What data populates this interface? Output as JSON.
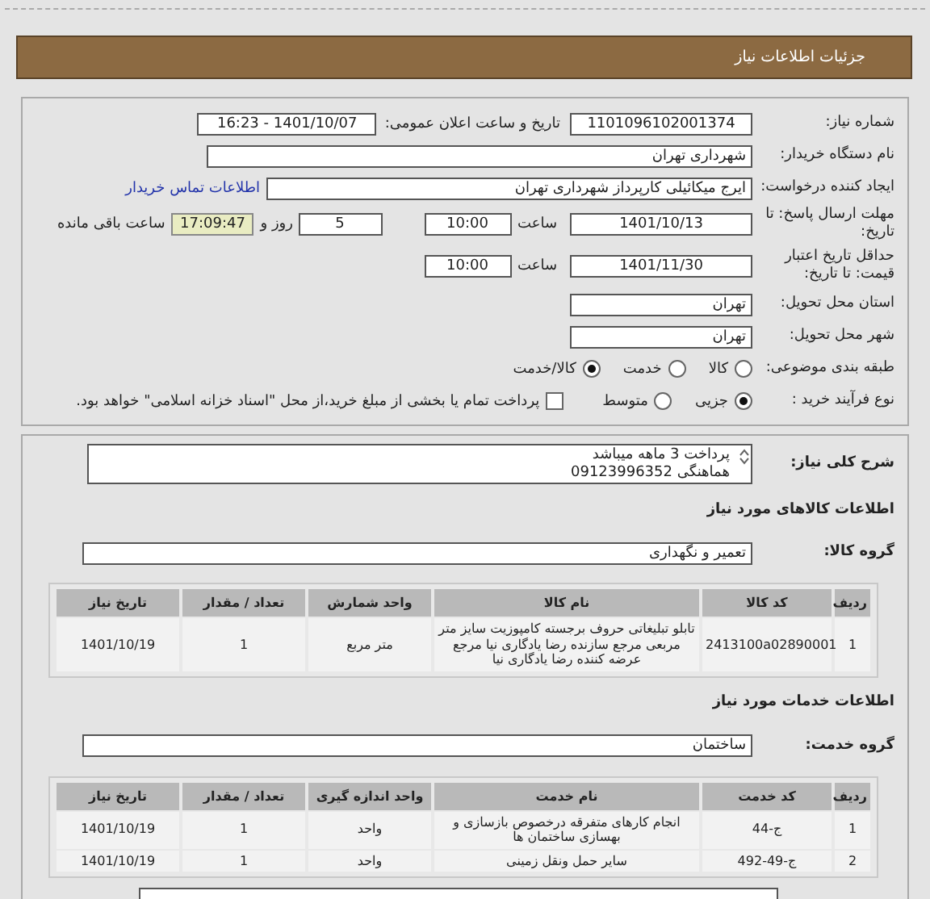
{
  "header": {
    "title": "جزئیات اطلاعات نیاز"
  },
  "need_number": {
    "label": "شماره نیاز:",
    "value": "1101096102001374"
  },
  "announce": {
    "label": "تاریخ و ساعت اعلان عمومی:",
    "value": "1401/10/07 - 16:23"
  },
  "buyer": {
    "label": "نام دستگاه خریدار:",
    "value": "شهرداری تهران"
  },
  "requester": {
    "label": "ایجاد کننده درخواست:",
    "value": "ایرج میکائیلی کارپرداز شهرداری تهران",
    "link": "اطلاعات تماس خریدار"
  },
  "deadline": {
    "label": "مهلت ارسال پاسخ: تا تاریخ:",
    "date": "1401/10/13",
    "time_label": "ساعت",
    "time": "10:00",
    "days": "5",
    "days_label": "روز و",
    "remaining": "17:09:47",
    "remaining_label": "ساعت باقی مانده"
  },
  "validity": {
    "label": "حداقل تاریخ اعتبار قیمت: تا تاریخ:",
    "date": "1401/11/30",
    "time_label": "ساعت",
    "time": "10:00"
  },
  "province": {
    "label": "استان محل تحویل:",
    "value": "تهران"
  },
  "city": {
    "label": "شهر محل تحویل:",
    "value": "تهران"
  },
  "category": {
    "label": "طبقه بندی موضوعی:",
    "options": [
      {
        "label": "کالا",
        "selected": false
      },
      {
        "label": "خدمت",
        "selected": false
      },
      {
        "label": "کالا/خدمت",
        "selected": true
      }
    ]
  },
  "process": {
    "label": "نوع فرآیند خرید :",
    "options": [
      {
        "label": "جزیی",
        "selected": true
      },
      {
        "label": "متوسط",
        "selected": false
      }
    ],
    "payment": {
      "label": "پرداخت تمام یا بخشی از مبلغ خرید،از محل \"اسناد خزانه اسلامی\" خواهد بود.",
      "checked": false
    }
  },
  "description": {
    "label": "شرح کلی نیاز:",
    "lines": [
      "پرداخت 3 ماهه میباشد",
      "هماهنگی 09123996352"
    ]
  },
  "goods": {
    "title": "اطلاعات کالاهای مورد نیاز",
    "group_label": "گروه کالا:",
    "group": "تعمیر و نگهداری",
    "columns": [
      "ردیف",
      "کد کالا",
      "نام کالا",
      "واحد شمارش",
      "تعداد / مقدار",
      "تاریخ نیاز"
    ],
    "rows": [
      [
        "1",
        "2413100a02890001",
        "تابلو تبلیغاتی حروف برجسته کامپوزیت سایز متر مربعی مرجع سازنده رضا یادگاری نیا مرجع عرضه کننده رضا یادگاری نیا",
        "متر مربع",
        "1",
        "1401/10/19"
      ]
    ]
  },
  "services": {
    "title": "اطلاعات خدمات مورد نیاز",
    "group_label": "گروه خدمت:",
    "group": "ساختمان",
    "columns": [
      "ردیف",
      "کد خدمت",
      "نام خدمت",
      "واحد اندازه گیری",
      "تعداد / مقدار",
      "تاریخ نیاز"
    ],
    "rows": [
      [
        "1",
        "ج-44",
        "انجام کارهای متفرقه درخصوص بازسازی و بهسازی ساختمان ها",
        "واحد",
        "1",
        "1401/10/19"
      ],
      [
        "2",
        "ج-49-492",
        "سایر حمل ونقل زمینی",
        "واحد",
        "1",
        "1401/10/19"
      ]
    ]
  }
}
